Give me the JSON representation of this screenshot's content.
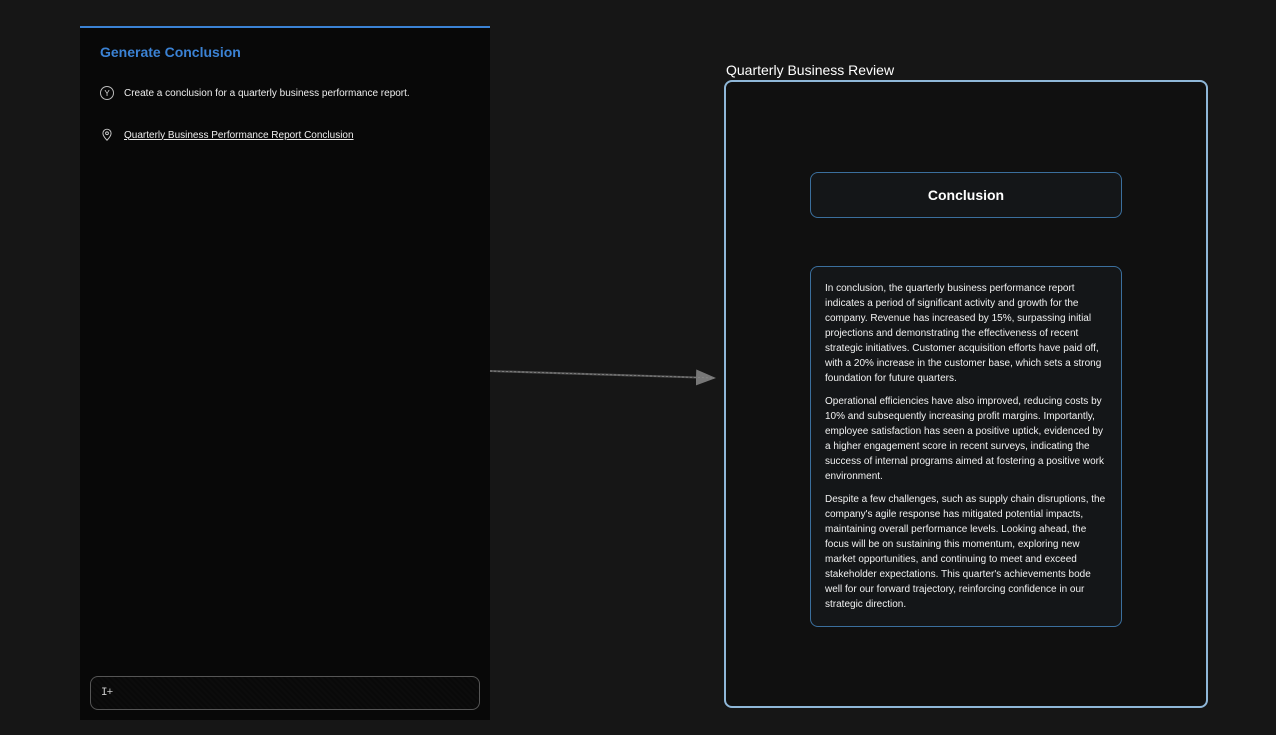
{
  "left": {
    "title": "Generate Conclusion",
    "user_icon_letter": "Y",
    "user_message": "Create a conclusion for a quarterly business performance report.",
    "assistant_link": "Quarterly Business Performance Report Conclusion",
    "input_placeholder": ""
  },
  "right": {
    "doc_title": "Quarterly Business Review",
    "section_heading": "Conclusion",
    "paragraphs": [
      "In conclusion, the quarterly business performance report indicates a period of significant activity and growth for the company. Revenue has increased by 15%, surpassing initial projections and demonstrating the effectiveness of recent strategic initiatives. Customer acquisition efforts have paid off, with a 20% increase in the customer base, which sets a strong foundation for future quarters.",
      "Operational efficiencies have also improved, reducing costs by 10% and subsequently increasing profit margins. Importantly, employee satisfaction has seen a positive uptick, evidenced by a higher engagement score in recent surveys, indicating the success of internal programs aimed at fostering a positive work environment.",
      "Despite a few challenges, such as supply chain disruptions, the company's agile response has mitigated potential impacts, maintaining overall performance levels. Looking ahead, the focus will be on sustaining this momentum, exploring new market opportunities, and continuing to meet and exceed stakeholder expectations. This quarter's achievements bode well for our forward trajectory, reinforcing confidence in our strategic direction."
    ]
  },
  "icons": {
    "text_cursor": "I+"
  }
}
